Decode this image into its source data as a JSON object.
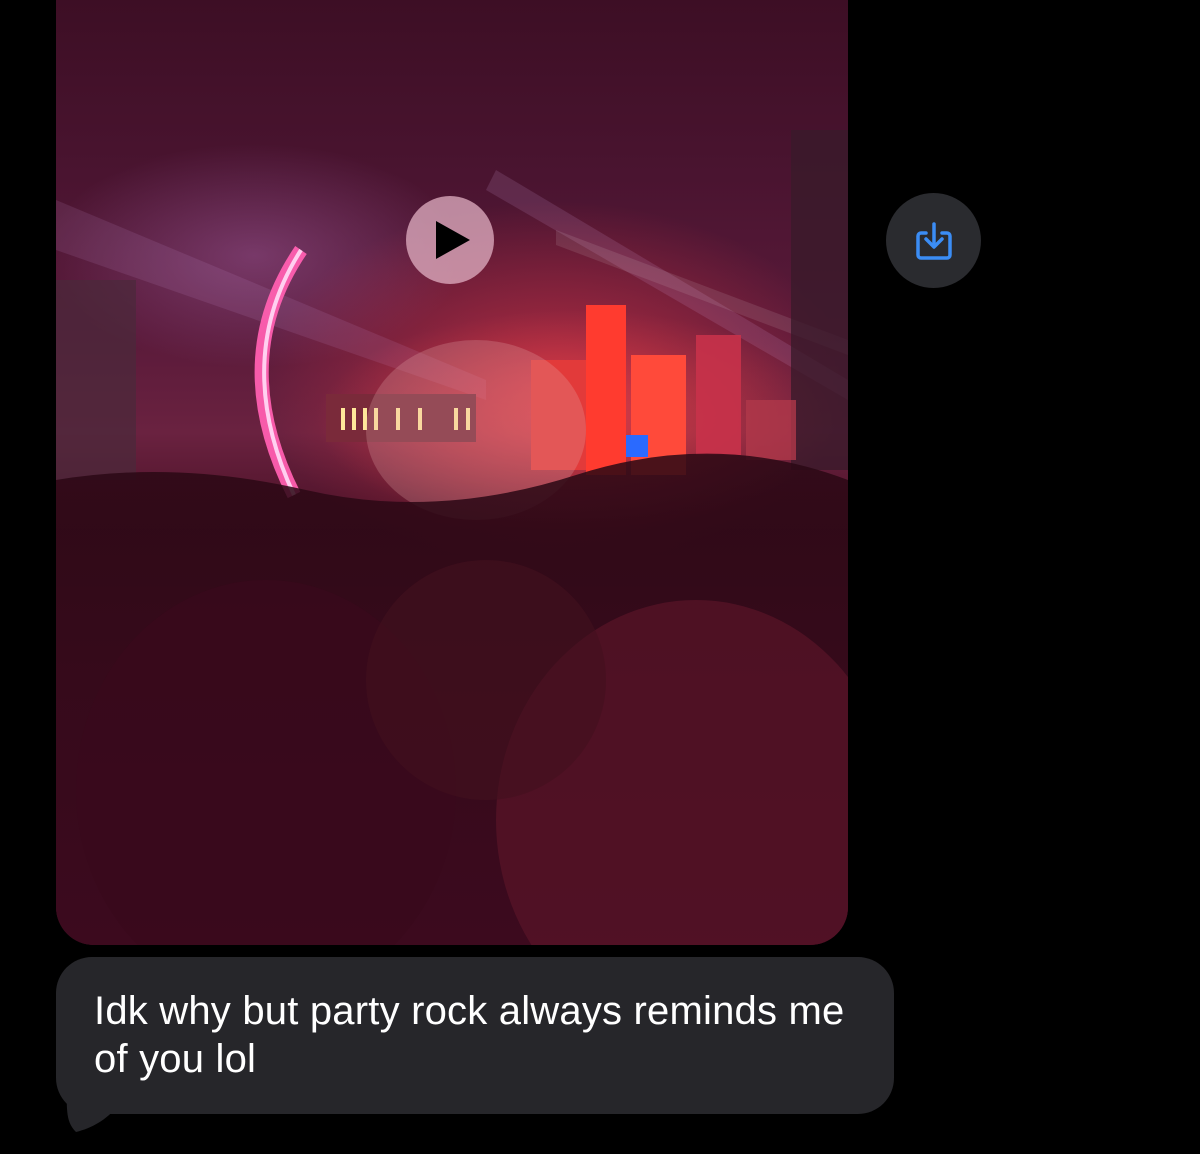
{
  "conversation": {
    "video_message": {
      "play_icon": "play-icon",
      "save_icon": "save-to-files-icon"
    },
    "text_message": {
      "text": "Idk why but party rock always reminds me of you lol"
    }
  },
  "colors": {
    "background": "#000000",
    "bubble": "#26262a",
    "save_button_bg": "#2a2b2f",
    "accent_blue": "#3b8df5"
  }
}
